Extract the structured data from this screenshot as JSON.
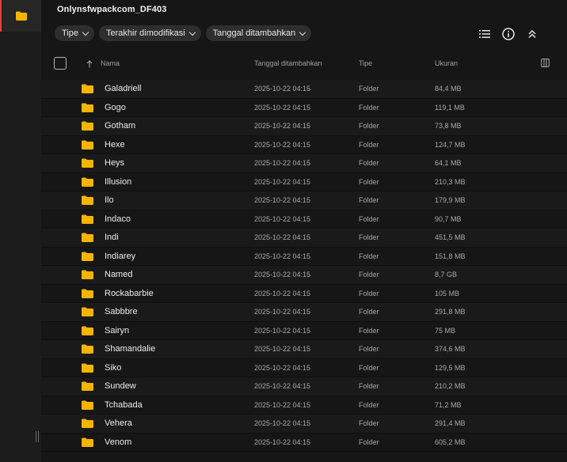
{
  "sidebar": {
    "icons": [
      "folder-icon"
    ]
  },
  "title": "Onlynsfwpackcom_DF403",
  "filters": [
    {
      "label": "Tipe"
    },
    {
      "label": "Terakhir dimodifikasi"
    },
    {
      "label": "Tanggal ditambahkan"
    }
  ],
  "toolbar": {
    "icons": [
      "list-view-icon",
      "info-icon",
      "collapse-icon"
    ]
  },
  "columns": {
    "name": "Nama",
    "date_added": "Tanggal ditambahkan",
    "type": "Tipe",
    "size": "Ukuran"
  },
  "rows": [
    {
      "name": "Galadriell",
      "date": "2025-10-22 04:15",
      "type": "Folder",
      "size": "84,4 MB"
    },
    {
      "name": "Gogo",
      "date": "2025-10-22 04:15",
      "type": "Folder",
      "size": "119,1 MB"
    },
    {
      "name": "Gotham",
      "date": "2025-10-22 04:15",
      "type": "Folder",
      "size": "73,8 MB"
    },
    {
      "name": "Hexe",
      "date": "2025-10-22 04:15",
      "type": "Folder",
      "size": "124,7 MB"
    },
    {
      "name": "Heys",
      "date": "2025-10-22 04:15",
      "type": "Folder",
      "size": "64,1 MB"
    },
    {
      "name": "Illusion",
      "date": "2025-10-22 04:15",
      "type": "Folder",
      "size": "210,3 MB"
    },
    {
      "name": "Ilo",
      "date": "2025-10-22 04:15",
      "type": "Folder",
      "size": "179,9 MB"
    },
    {
      "name": "Indaco",
      "date": "2025-10-22 04:15",
      "type": "Folder",
      "size": "90,7 MB"
    },
    {
      "name": "Indi",
      "date": "2025-10-22 04:15",
      "type": "Folder",
      "size": "451,5 MB"
    },
    {
      "name": "Indiarey",
      "date": "2025-10-22 04:15",
      "type": "Folder",
      "size": "151,8 MB"
    },
    {
      "name": "Named",
      "date": "2025-10-22 04:15",
      "type": "Folder",
      "size": "8,7 GB"
    },
    {
      "name": "Rockabarbie",
      "date": "2025-10-22 04:15",
      "type": "Folder",
      "size": "105 MB"
    },
    {
      "name": "Sabbbre",
      "date": "2025-10-22 04:15",
      "type": "Folder",
      "size": "291,8 MB"
    },
    {
      "name": "Sairyn",
      "date": "2025-10-22 04:15",
      "type": "Folder",
      "size": "75 MB"
    },
    {
      "name": "Shamandalie",
      "date": "2025-10-22 04:15",
      "type": "Folder",
      "size": "374,6 MB"
    },
    {
      "name": "Siko",
      "date": "2025-10-22 04:15",
      "type": "Folder",
      "size": "129,5 MB"
    },
    {
      "name": "Sundew",
      "date": "2025-10-22 04:15",
      "type": "Folder",
      "size": "210,2 MB"
    },
    {
      "name": "Tchabada",
      "date": "2025-10-22 04:15",
      "type": "Folder",
      "size": "71,2 MB"
    },
    {
      "name": "Vehera",
      "date": "2025-10-22 04:15",
      "type": "Folder",
      "size": "291,4 MB"
    },
    {
      "name": "Venom",
      "date": "2025-10-22 04:15",
      "type": "Folder",
      "size": "605,2 MB"
    }
  ],
  "colors": {
    "folder": "#f5b400",
    "accent": "#e0423a",
    "background": "#161616"
  }
}
